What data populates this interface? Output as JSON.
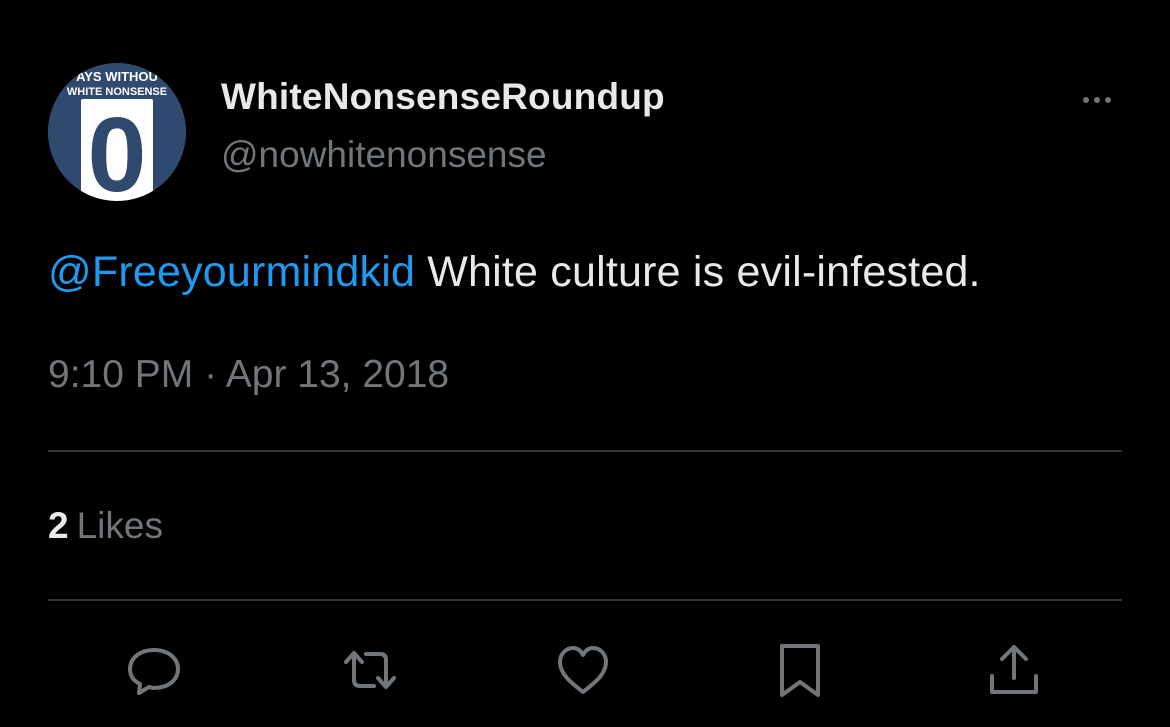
{
  "author": {
    "display_name": "WhiteNonsenseRoundup",
    "handle": "@nowhitenonsense",
    "avatar": {
      "top_text": "AYS WITHOU",
      "mid_text": "WHITE NONSENSE",
      "number": "0",
      "background": "#2f4a6e"
    }
  },
  "tweet": {
    "mention": "@Freeyourmindkid",
    "text": " White culture is evil-infested.",
    "timestamp": "9:10 PM · Apr 13, 2018"
  },
  "stats": {
    "likes_count": "2",
    "likes_label": "Likes"
  },
  "actions": [
    {
      "icon": "reply-icon"
    },
    {
      "icon": "retweet-icon"
    },
    {
      "icon": "like-icon"
    },
    {
      "icon": "bookmark-icon"
    },
    {
      "icon": "share-icon"
    }
  ],
  "colors": {
    "background": "#000000",
    "text_primary": "#e7e9ea",
    "text_secondary": "#71767b",
    "accent": "#1d9bf0",
    "divider": "#2f3336"
  }
}
